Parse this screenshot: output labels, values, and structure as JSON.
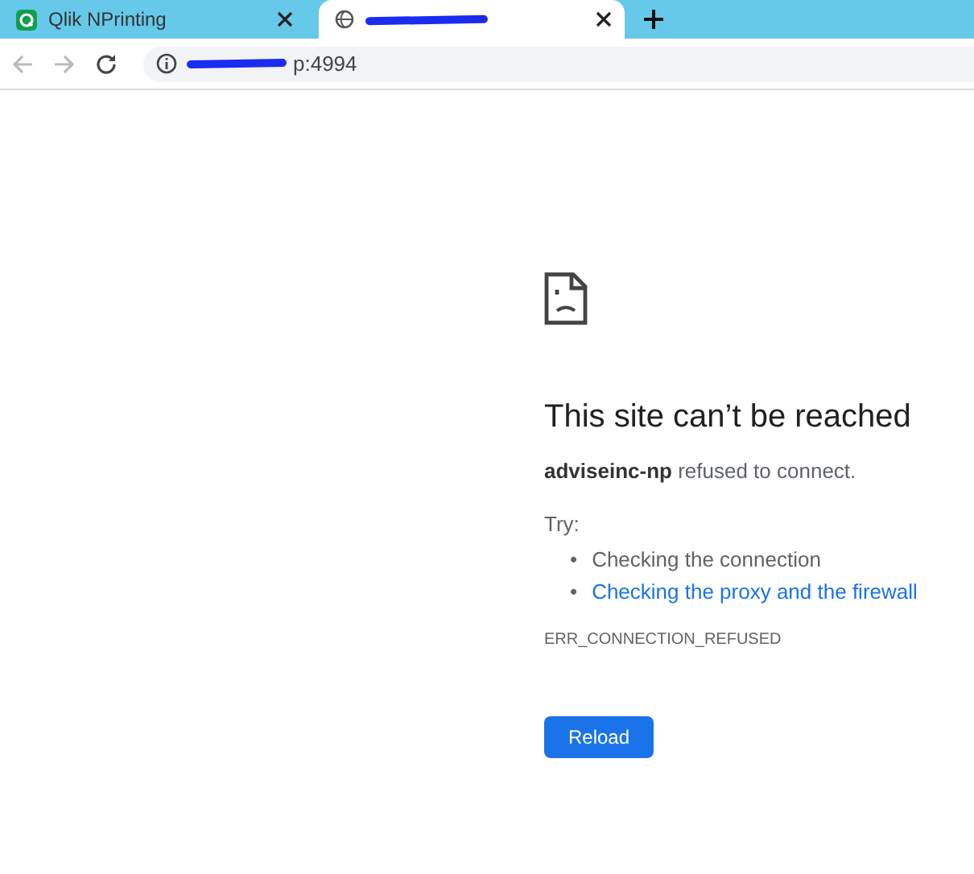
{
  "tabs": [
    {
      "title": "Qlik NPrinting",
      "selected": false,
      "redacted": false
    },
    {
      "selected": true,
      "redacted": true
    }
  ],
  "address_bar": {
    "url": "p:4994",
    "redacted": true
  },
  "error": {
    "heading": "This site can’t be reached",
    "message": "**adviseinc-np** refused to connect.",
    "try_label": "Try:",
    "suggestions": [
      {
        "bullet": "•",
        "text": "Checking the connection",
        "link": false
      },
      {
        "bullet": "•",
        "text": "Checking the proxy and the firewall",
        "link": true
      }
    ],
    "code": "ERR_CONNECTION_REFUSED",
    "button": "Reload"
  }
}
